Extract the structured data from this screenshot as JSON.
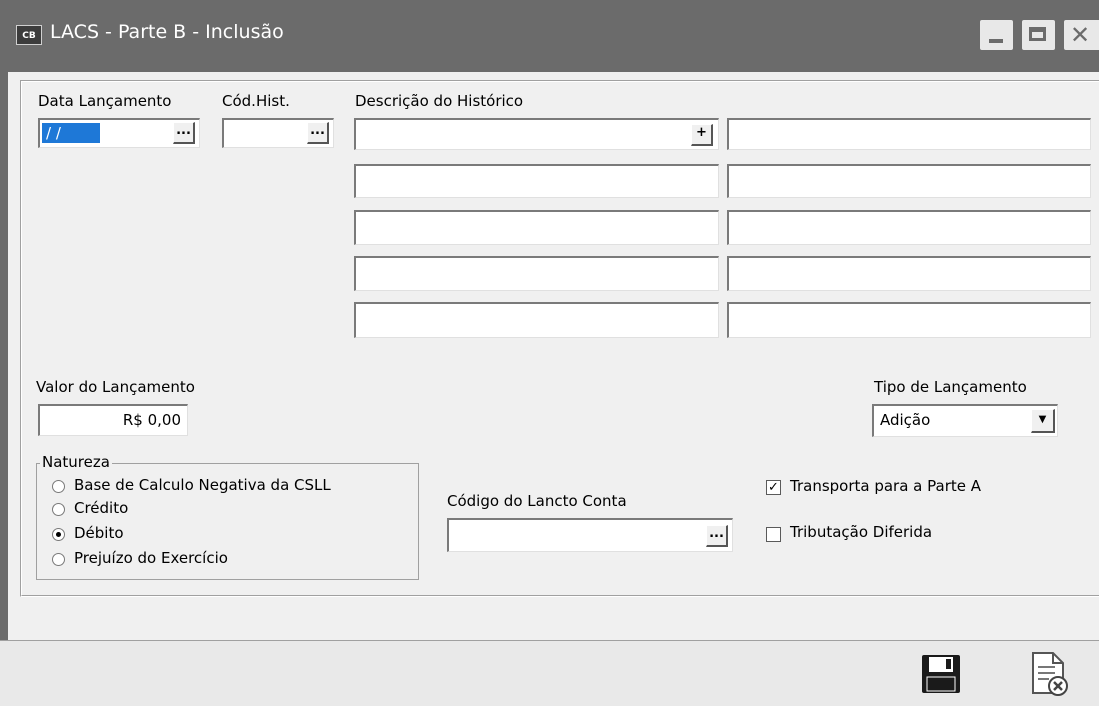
{
  "window": {
    "app_icon_text": "CB",
    "title": "LACS - Parte B - Inclusão",
    "minimize_icon": "minimize-icon",
    "maximize_icon": "maximize-icon",
    "close_icon": "close-icon"
  },
  "form": {
    "data_lancamento_label": "Data Lançamento",
    "data_lancamento_value": " / /",
    "cod_hist_label": "Cód.Hist.",
    "cod_hist_value": "",
    "descricao_label": "Descrição do Histórico",
    "descricao_lines": [
      "",
      "",
      "",
      "",
      "",
      "",
      "",
      "",
      "",
      ""
    ],
    "valor_label": "Valor do Lançamento",
    "valor_value": "R$ 0,00",
    "tipo_label": "Tipo de Lançamento",
    "tipo_value": "Adição",
    "natureza_label": "Natureza",
    "natureza_options": [
      {
        "label": "Base de Calculo Negativa da CSLL",
        "selected": false
      },
      {
        "label": "Crédito",
        "selected": false
      },
      {
        "label": "Débito",
        "selected": true
      },
      {
        "label": "Prejuízo do Exercício",
        "selected": false
      }
    ],
    "codigo_lancto_label": "Código do Lancto Conta",
    "codigo_lancto_value": "",
    "transporta_label": "Transporta para a Parte A",
    "transporta_checked": true,
    "tributacao_label": "Tributação Diferida",
    "tributacao_checked": false,
    "ellipsis": "...",
    "plus": "+"
  },
  "toolbar": {
    "save_icon": "save-icon",
    "cancel_icon": "cancel-document-icon"
  },
  "colors": {
    "titlebar": "#6b6b6b",
    "selection": "#1e78d7"
  }
}
